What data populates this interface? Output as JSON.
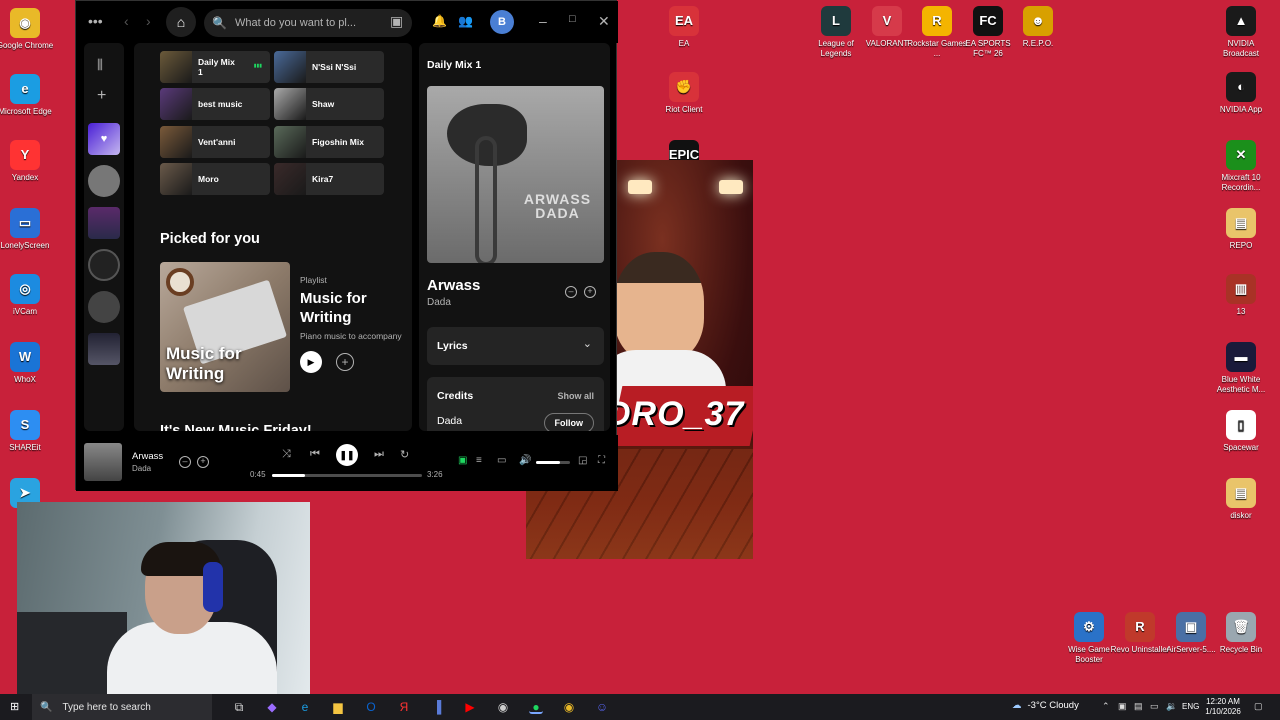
{
  "desktop": {
    "icons_left": [
      {
        "label": "Google Chrome",
        "color": "#e9b928",
        "glyph": "◉"
      },
      {
        "label": "Microsoft Edge",
        "color": "#1b9de2",
        "glyph": "e"
      },
      {
        "label": "Yandex",
        "color": "#f33",
        "glyph": "Y"
      },
      {
        "label": "LonelyScreen",
        "color": "#2a6fd6",
        "glyph": "▭"
      },
      {
        "label": "iVCam",
        "color": "#1c8be0",
        "glyph": "◎"
      },
      {
        "label": "WhoX",
        "color": "#1a74d6",
        "glyph": "W"
      },
      {
        "label": "SHAREit",
        "color": "#2d8ef2",
        "glyph": "S"
      },
      {
        "label": "Te",
        "color": "#2aa3e0",
        "glyph": "➤"
      }
    ],
    "icons_mid": [
      {
        "label": "EA",
        "color": "#d8323a",
        "glyph": "EA"
      },
      {
        "label": "Riot Client",
        "color": "#d8323a",
        "glyph": "✊"
      },
      {
        "label": "Epic Games Launcher",
        "color": "#111",
        "glyph": "EPIC"
      }
    ],
    "icons_top": [
      {
        "label": "League of Legends",
        "color": "#1f3a3d",
        "glyph": "L"
      },
      {
        "label": "VALORANT",
        "color": "#d63a4a",
        "glyph": "V"
      },
      {
        "label": "Rockstar Games ...",
        "color": "#f4b400",
        "glyph": "R"
      },
      {
        "label": "EA SPORTS FC™ 26",
        "color": "#111",
        "glyph": "FC"
      },
      {
        "label": "R.E.P.O.",
        "color": "#d8a000",
        "glyph": "☻"
      }
    ],
    "icons_right": [
      {
        "label": "NVIDIA Broadcast",
        "color": "#1a1a1a",
        "glyph": "▲"
      },
      {
        "label": "NVIDIA App",
        "color": "#1a1a1a",
        "glyph": "◐"
      },
      {
        "label": "Mixcraft 10 Recordin...",
        "color": "#1b8f1b",
        "glyph": "✕"
      },
      {
        "label": "REPO",
        "color": "#e9c46a",
        "glyph": "▤"
      },
      {
        "label": "13",
        "color": "#a93226",
        "glyph": "▥"
      },
      {
        "label": "Blue White Aesthetic M...",
        "color": "#1a1a3a",
        "glyph": "▬"
      },
      {
        "label": "Spacewar",
        "color": "#ffffff",
        "glyph": "▯"
      },
      {
        "label": "diskor",
        "color": "#e9c46a",
        "glyph": "▤"
      }
    ],
    "icons_bottom": [
      {
        "label": "Wise Game Booster",
        "color": "#2a72c8",
        "glyph": "⚙"
      },
      {
        "label": "Revo Uninstaller",
        "color": "#c0392b",
        "glyph": "R"
      },
      {
        "label": "AirServer-5....",
        "color": "#4a6fa5",
        "glyph": "▣"
      },
      {
        "label": "Recycle Bin",
        "color": "#9aa7b0",
        "glyph": "🗑"
      }
    ],
    "poster_text": "DRO_37"
  },
  "spotify": {
    "search_placeholder": "What do you want to pl...",
    "avatar_letter": "B",
    "quick_tiles": [
      {
        "label": "Daily Mix 1",
        "color": "#6b5a3a",
        "playing": true
      },
      {
        "label": "N'Ssi N'Ssi",
        "color": "#4a6a9a",
        "playing": false
      },
      {
        "label": "best music",
        "color": "#5a3a7a",
        "playing": false
      },
      {
        "label": "Shaw",
        "color": "#aaaaaa",
        "playing": false
      },
      {
        "label": "Vent'anni",
        "color": "#7a5a3a",
        "playing": false
      },
      {
        "label": "Figoshin Mix",
        "color": "#5a6a5a",
        "playing": false
      },
      {
        "label": "Moro",
        "color": "#6a5a4a",
        "playing": false
      },
      {
        "label": "Kira7",
        "color": "#3a2a2a",
        "playing": false
      }
    ],
    "picked_heading": "Picked for you",
    "playlist": {
      "kind": "Playlist",
      "title": "Music for Writing",
      "cover_text": "Music for Writing",
      "desc": "Piano music to accompany"
    },
    "next_heading": "It's New Music Friday!",
    "now_playing_panel": {
      "header": "Daily Mix 1",
      "album_art_text": "ARWASS DADA",
      "track": "Arwass",
      "artist": "Dada",
      "lyrics_label": "Lyrics",
      "credits_label": "Credits",
      "show_all": "Show all",
      "credit_name": "Dada",
      "follow_label": "Follow"
    },
    "player": {
      "track": "Arwass",
      "artist": "Dada",
      "elapsed": "0:45",
      "total": "3:26",
      "progress": 0.218,
      "volume": 0.7
    }
  },
  "taskbar": {
    "search_placeholder": "Type here to search",
    "weather": "-3°C  Cloudy",
    "language": "ENG",
    "time": "12:20 AM",
    "date": "1/10/2026"
  }
}
